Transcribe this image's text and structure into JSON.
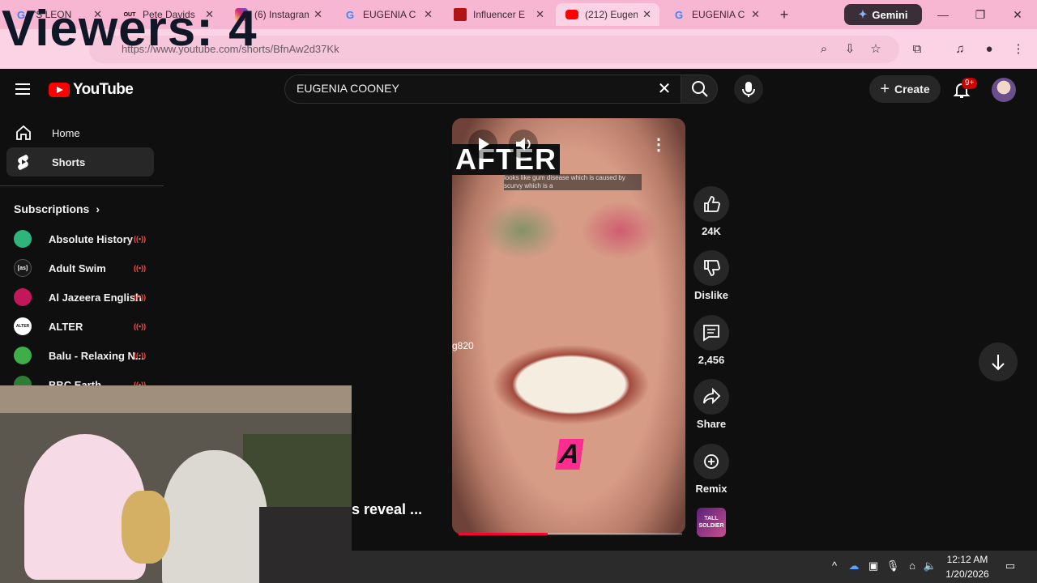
{
  "overlay": {
    "viewers_text": "Viewers: 4"
  },
  "browser": {
    "tabs": [
      {
        "title": "'S LEON",
        "favicon": "google-icon",
        "favicon_color": "#4285f4"
      },
      {
        "title": "Pete Davids",
        "favicon": "out-icon",
        "favicon_text": "OUT",
        "favicon_color": "#000000"
      },
      {
        "title": "(6) Instagram",
        "favicon": "instagram-icon",
        "favicon_color": "#d6249f"
      },
      {
        "title": "EUGENIA C",
        "favicon": "google-icon",
        "favicon_color": "#4285f4"
      },
      {
        "title": "Influencer E",
        "favicon": "site-icon",
        "favicon_color": "#b01515"
      },
      {
        "title": "(212) Eugen",
        "favicon": "youtube-icon",
        "favicon_color": "#ff0000",
        "active": true
      },
      {
        "title": "EUGENIA C",
        "favicon": "google-icon",
        "favicon_color": "#4285f4"
      }
    ],
    "new_tab_icon": "plus-icon",
    "gemini_label": "Gemini",
    "url": "https://www.youtube.com/shorts/BfnAw2d37Kk"
  },
  "youtube": {
    "search": {
      "value": "EUGENIA COONEY",
      "placeholder": "Search"
    },
    "logo_text": "YouTube",
    "create_label": "Create",
    "notification_badge": "9+",
    "nav": [
      {
        "label": "Home",
        "icon": "home-icon"
      },
      {
        "label": "Shorts",
        "icon": "shorts-icon",
        "active": true
      }
    ],
    "subscriptions_title": "Subscriptions",
    "subscriptions": [
      {
        "name": "Absolute History",
        "color": "#2db57c",
        "live": true
      },
      {
        "name": "Adult Swim",
        "color": "#1a1a1a",
        "live": true
      },
      {
        "name": "Al Jazeera English",
        "color": "#c2185b",
        "live": true
      },
      {
        "name": "ALTER",
        "color": "#ffffff",
        "live": true,
        "avatar_text": "ALTER"
      },
      {
        "name": "Balu - Relaxing N...",
        "color": "#3fae49",
        "live": true
      },
      {
        "name": "BBC Earth",
        "color": "#2f7d32",
        "live": true
      }
    ],
    "short": {
      "overlay_title": "AFTER",
      "caption": "looks like gum disease which is caused by scurvy which is a",
      "letter": "A",
      "username_fragment": "g820",
      "title_fragment": "s reveal ...",
      "progress_percent": 40,
      "actions": [
        {
          "label": "24K",
          "icon": "like-icon"
        },
        {
          "label": "Dislike",
          "icon": "dislike-icon"
        },
        {
          "label": "2,456",
          "icon": "comment-icon"
        },
        {
          "label": "Share",
          "icon": "share-icon"
        },
        {
          "label": "Remix",
          "icon": "remix-icon"
        }
      ],
      "sound_thumb_text": "TALL SOLDIER"
    }
  },
  "taskbar": {
    "time": "12:12 AM",
    "date": "1/20/2026"
  }
}
